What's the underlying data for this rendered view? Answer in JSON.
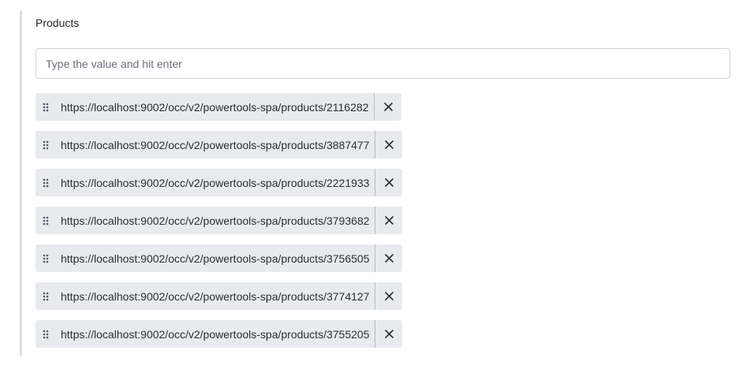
{
  "field": {
    "label": "Products",
    "placeholder": "Type the value and hit enter",
    "value": ""
  },
  "icons": {
    "drag": "drag-handle-icon",
    "remove": "close-icon"
  },
  "colors": {
    "tag_background": "#e8eaed",
    "panel_border": "#d9dce0"
  },
  "tags": [
    "https://localhost:9002/occ/v2/powertools-spa/products/2116282",
    "https://localhost:9002/occ/v2/powertools-spa/products/3887477",
    "https://localhost:9002/occ/v2/powertools-spa/products/2221933",
    "https://localhost:9002/occ/v2/powertools-spa/products/3793682",
    "https://localhost:9002/occ/v2/powertools-spa/products/3756505",
    "https://localhost:9002/occ/v2/powertools-spa/products/3774127",
    "https://localhost:9002/occ/v2/powertools-spa/products/3755205"
  ]
}
